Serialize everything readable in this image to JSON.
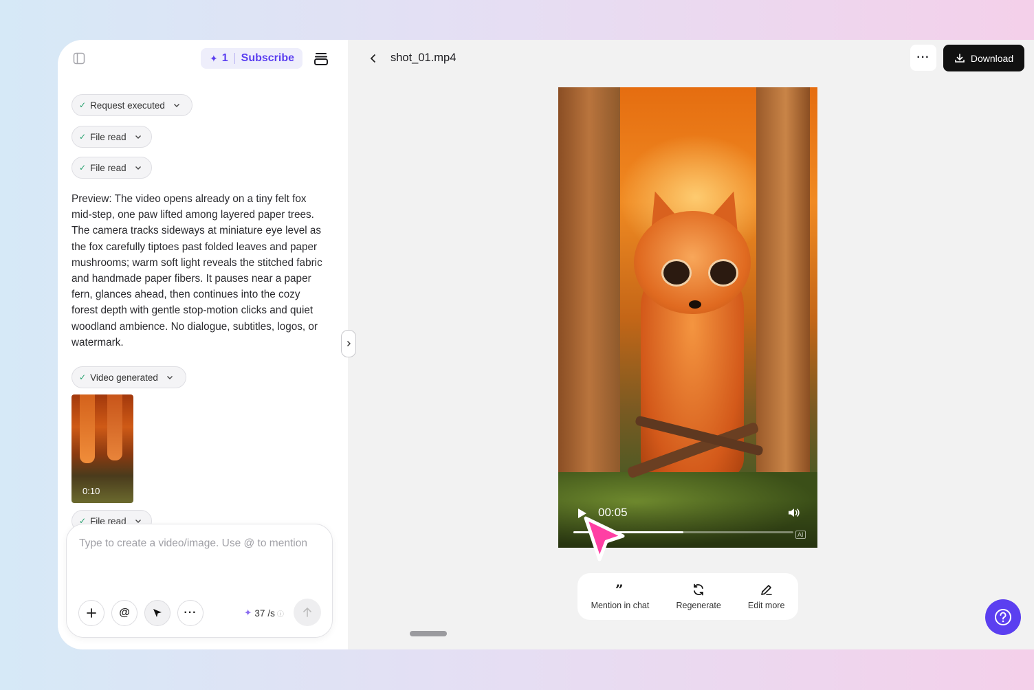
{
  "header": {
    "credits_badge": "1",
    "subscribe_label": "Subscribe"
  },
  "chat": {
    "chips": [
      {
        "label": "Request executed"
      },
      {
        "label": "File read"
      },
      {
        "label": "File read"
      },
      {
        "label": "Video generated"
      },
      {
        "label": "File read"
      }
    ],
    "preview_text": "Preview: The video opens already on a tiny felt fox mid-step, one paw lifted among layered paper trees. The camera tracks sideways at miniature eye level as the fox carefully tiptoes past folded leaves and paper mushrooms; warm soft light reveals the stitched fabric and handmade paper fibers. It pauses near a paper fern, glances ahead, then continues into the cozy forest depth with gentle stop-motion clicks and quiet woodland ambience. No dialogue, subtitles, logos, or watermark.",
    "thumbnail_duration": "0:10"
  },
  "composer": {
    "placeholder": "Type to create a video/image. Use @ to mention",
    "credits_value": "37",
    "credits_unit": "/s"
  },
  "viewer": {
    "file_name": "shot_01.mp4",
    "download_label": "Download",
    "current_time": "00:05",
    "progress_fraction": 0.5,
    "ai_badge": "AI"
  },
  "actions": {
    "mention": "Mention in chat",
    "regenerate": "Regenerate",
    "edit": "Edit more"
  },
  "colors": {
    "accent": "#5b3ff0",
    "success": "#22a06b"
  }
}
